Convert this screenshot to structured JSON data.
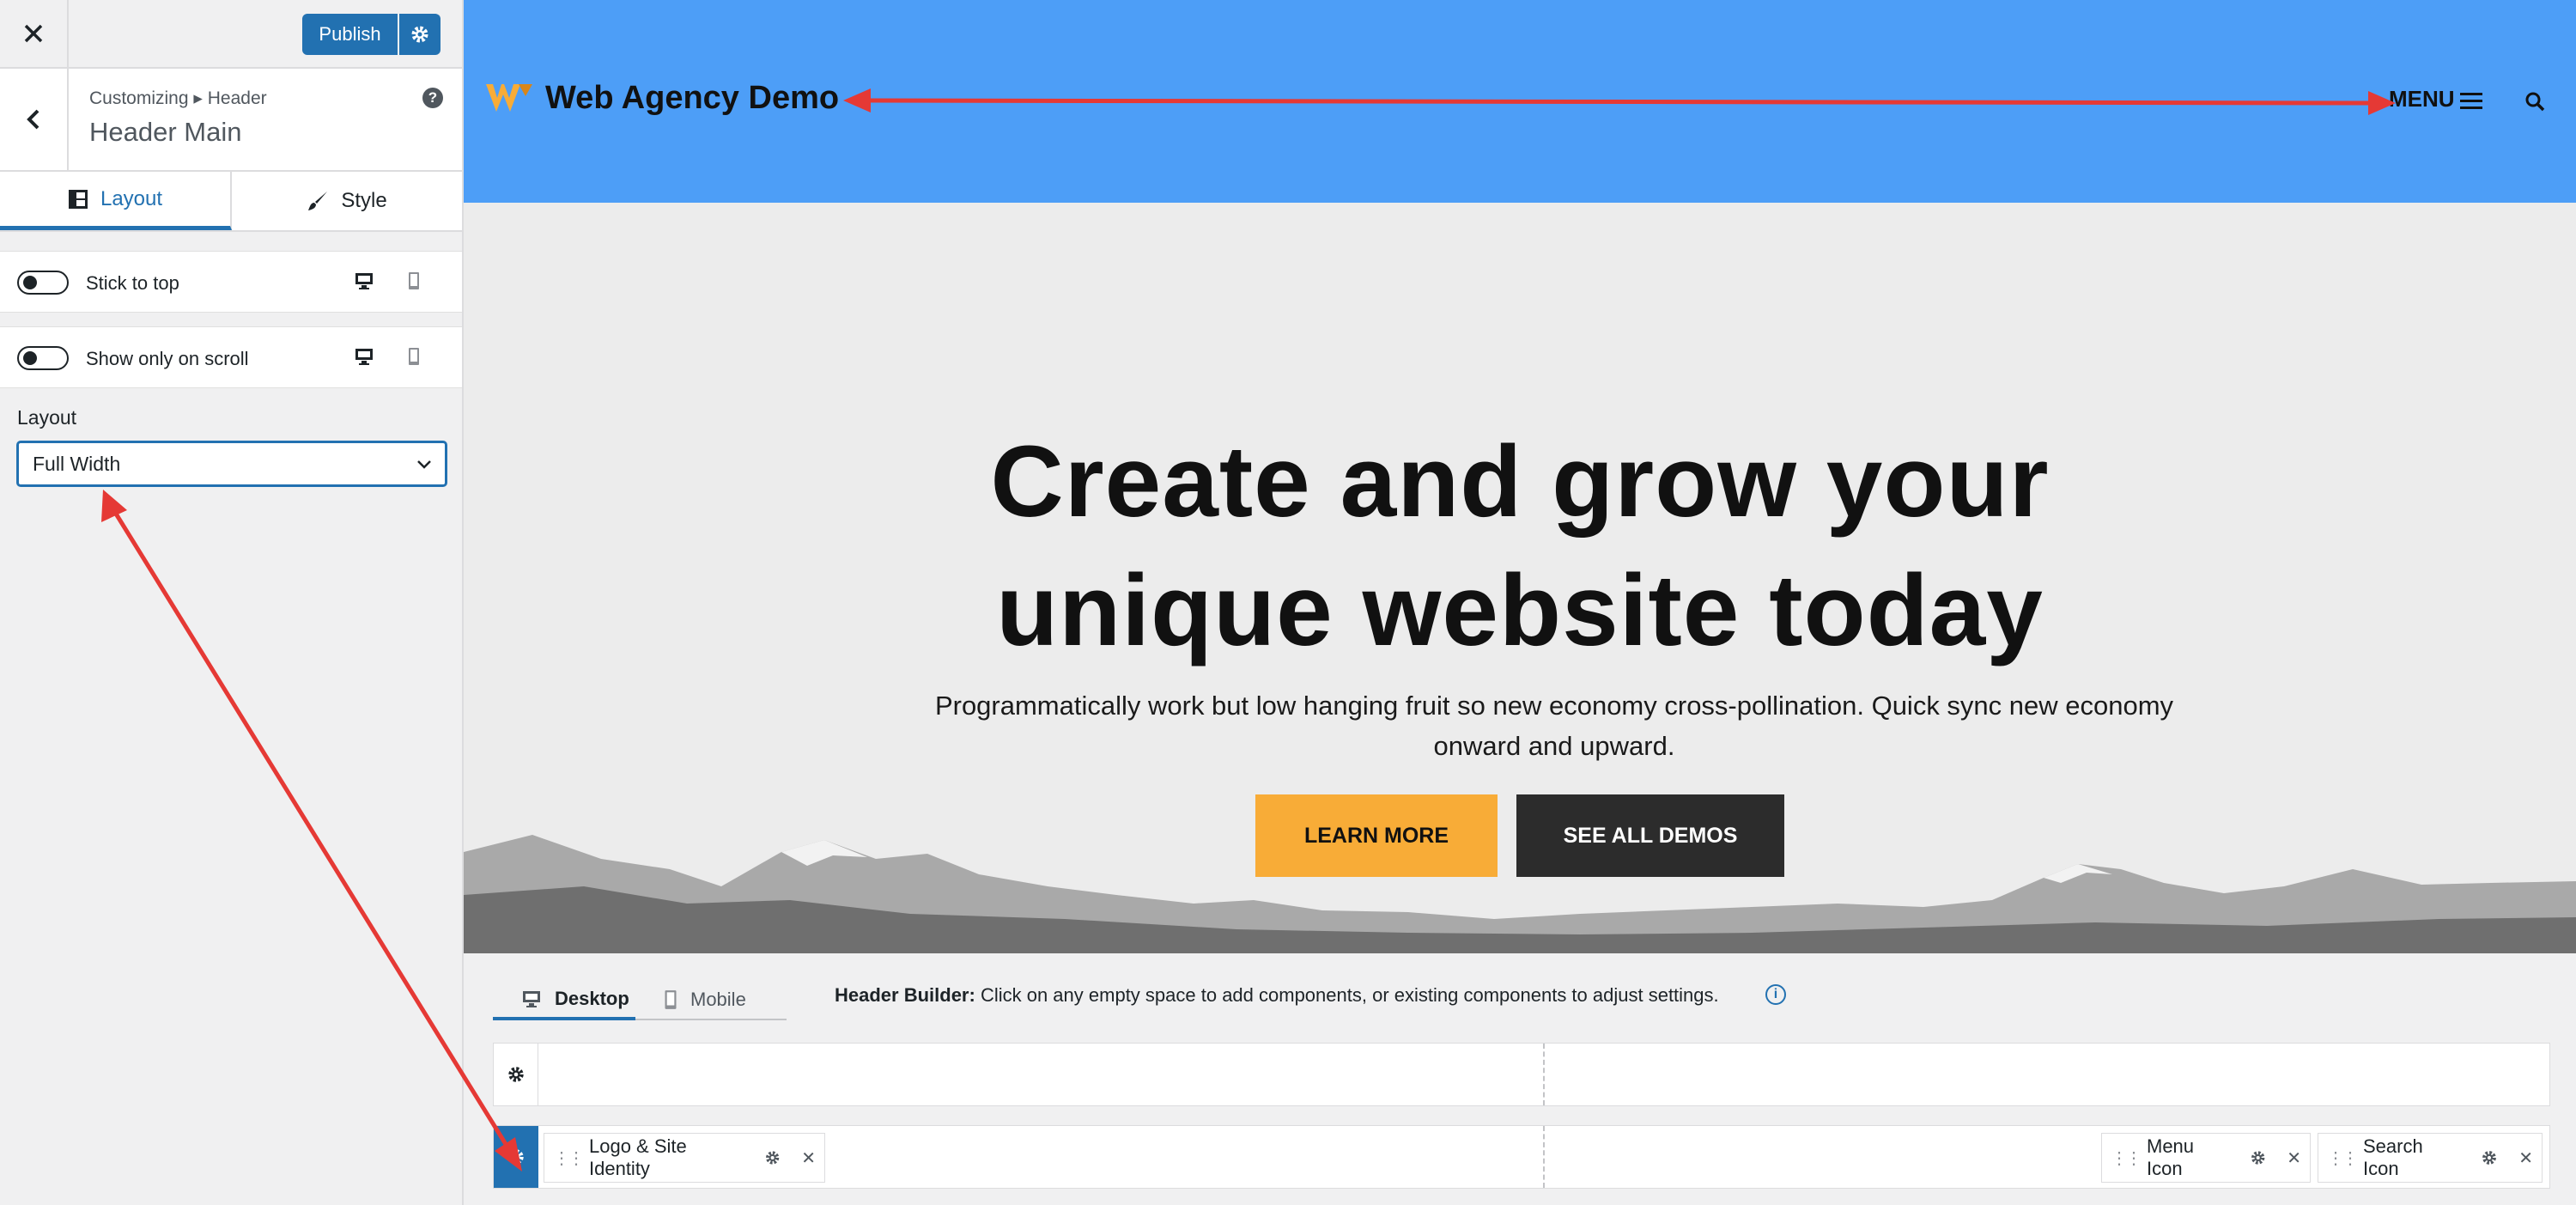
{
  "sidebar": {
    "publish_label": "Publish",
    "breadcrumb": "Customizing ▸ Header",
    "section_title": "Header Main",
    "tabs": [
      {
        "label": "Layout",
        "active": true
      },
      {
        "label": "Style",
        "active": false
      }
    ],
    "options": [
      {
        "label": "Stick to top",
        "enabled": false
      },
      {
        "label": "Show only on scroll",
        "enabled": false
      }
    ],
    "layout_label": "Layout",
    "layout_value": "Full Width"
  },
  "preview": {
    "site_title": "Web Agency Demo",
    "menu_label": "MENU",
    "hero_heading_line1": "Create and grow your",
    "hero_heading_line2": "unique website today",
    "hero_text": "Programmatically work but low hanging fruit so new economy cross-pollination. Quick sync new economy onward and upward.",
    "btn_learn": "LEARN MORE",
    "btn_demos": "SEE ALL DEMOS"
  },
  "builder": {
    "tab_desktop": "Desktop",
    "tab_mobile": "Mobile",
    "info_label": "Header Builder:",
    "info_text": "Click on any empty space to add components, or existing components to adjust settings.",
    "components": [
      "Logo & Site Identity",
      "Menu Icon",
      "Search Icon"
    ]
  },
  "colors": {
    "accent": "#2271b1",
    "header_bg": "#4d9ef7",
    "button_primary": "#f8ac37",
    "button_dark": "#2c2c2c",
    "annotation": "#e53935"
  }
}
